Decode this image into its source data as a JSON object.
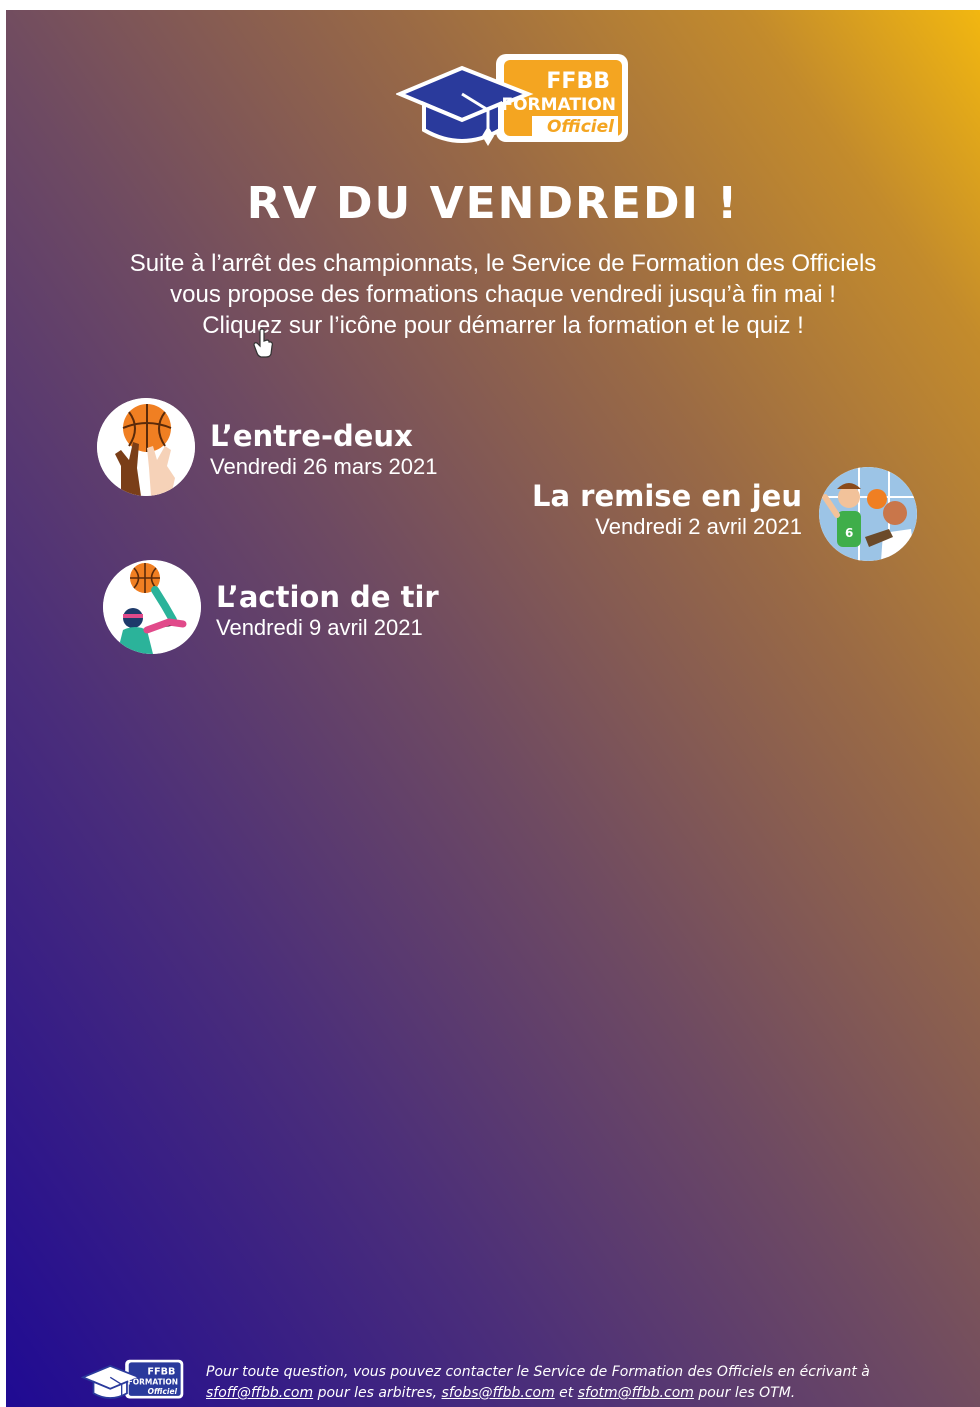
{
  "logo": {
    "line1": "FFBB",
    "line2": "FORMATION",
    "line3": "Officiel"
  },
  "title": "RV DU VENDREDI !",
  "intro": [
    "Suite à l’arrêt des championnats, le Service de Formation des Officiels",
    "vous propose des formations chaque vendredi jusqu’à fin mai !",
    "Cliquez sur l’icône pour démarrer la formation et le quiz !"
  ],
  "trainings": [
    {
      "name": "L’entre-deux",
      "date": "Vendredi 26 mars 2021",
      "icon": "jump-ball-icon"
    },
    {
      "name": "La remise en jeu",
      "date": "Vendredi 2 avril 2021",
      "icon": "throw-in-icon"
    },
    {
      "name": "L’action de tir",
      "date": "Vendredi 9 avril 2021",
      "icon": "shooter-icon"
    }
  ],
  "footer": {
    "line1": "Pour toute question, vous pouvez contacter le Service de Formation des Officiels en écrivant à",
    "email1": "sfoff@ffbb.com",
    "text1": " pour les arbitres, ",
    "email2": "sfobs@ffbb.com",
    "text2": " et ",
    "email3": "sfotm@ffbb.com",
    "text3": " pour les OTM."
  },
  "colors": {
    "gradient_start": "#1f0a93",
    "gradient_end": "#f2b710",
    "logo_orange": "#f4a521",
    "logo_blue": "#2a3a9c",
    "ball": "#f07f22"
  }
}
